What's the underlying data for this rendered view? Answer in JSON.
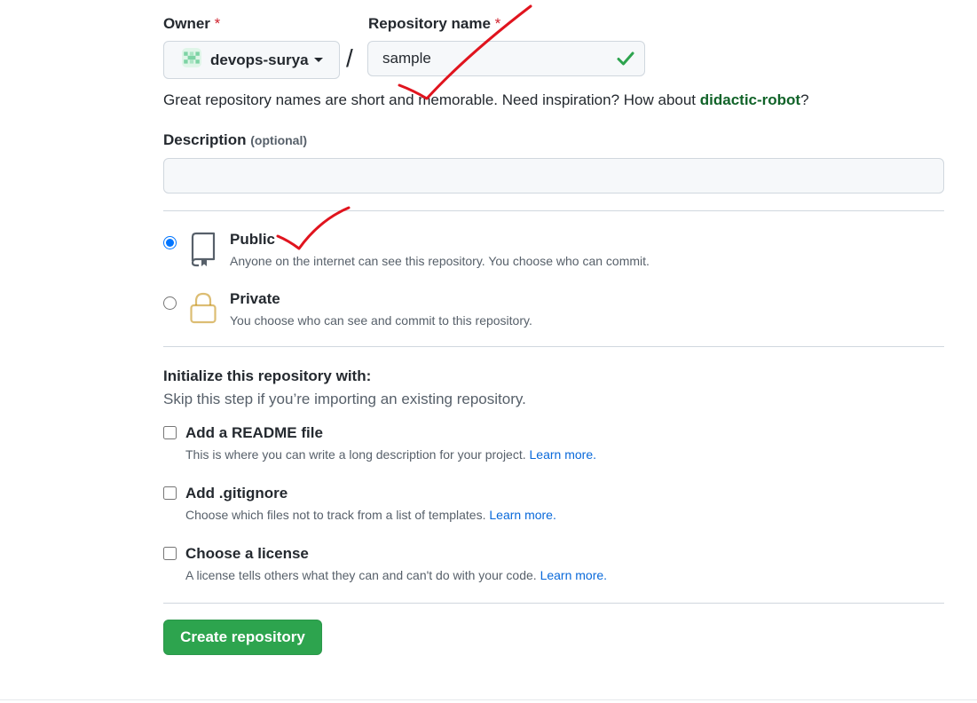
{
  "owner": {
    "label": "Owner",
    "required_mark": "*",
    "name": "devops-surya"
  },
  "repository": {
    "label": "Repository name",
    "required_mark": "*",
    "value": "sample",
    "hint_prefix": "Great repository names are short and memorable. Need inspiration? How about ",
    "suggestion": "didactic-robot",
    "hint_suffix": "?"
  },
  "separator": "/",
  "description": {
    "label": "Description",
    "optional": "(optional)",
    "value": ""
  },
  "visibility": {
    "selected": "public",
    "options": [
      {
        "id": "public",
        "title": "Public",
        "desc": "Anyone on the internet can see this repository. You choose who can commit."
      },
      {
        "id": "private",
        "title": "Private",
        "desc": "You choose who can see and commit to this repository."
      }
    ]
  },
  "initialize": {
    "title": "Initialize this repository with:",
    "subtitle": "Skip this step if you’re importing an existing repository.",
    "options": [
      {
        "label": "Add a README file",
        "desc": "This is where you can write a long description for your project.",
        "link": "Learn more."
      },
      {
        "label": "Add .gitignore",
        "desc": "Choose which files not to track from a list of templates.",
        "link": "Learn more."
      },
      {
        "label": "Choose a license",
        "desc": "A license tells others what they can and can't do with your code.",
        "link": "Learn more."
      }
    ]
  },
  "create_button": "Create repository",
  "colors": {
    "primary_button": "#2da44e",
    "link": "#0969da",
    "suggestion": "#116329",
    "required": "#cf222e",
    "annotation": "#e0141e"
  },
  "icons": {
    "owner_avatar": "identicon-avatar",
    "dropdown": "caret-down-icon",
    "valid": "check-icon",
    "public": "repo-book-icon",
    "private": "lock-icon"
  }
}
